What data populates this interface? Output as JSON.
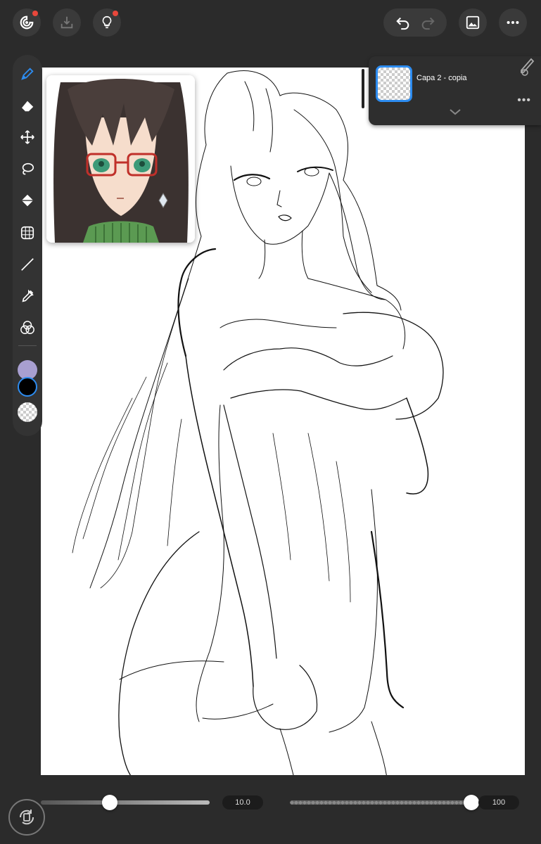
{
  "top_bar": {
    "icons": [
      "logo-icon",
      "import-icon",
      "lightbulb-icon",
      "undo-icon",
      "redo-icon",
      "gallery-icon",
      "more-icon"
    ],
    "notification_color": "#e8473b"
  },
  "tools": [
    "pen-icon",
    "eraser-icon",
    "move-icon",
    "lasso-icon",
    "fill-icon",
    "perspective-grid-icon",
    "line-icon",
    "eyedropper-icon",
    "blend-icon"
  ],
  "colors": {
    "primary": "#a89fd0",
    "secondary": "#000000",
    "accent": "#2d8cf0"
  },
  "layers_panel": {
    "layer_name": "Capa 2 - copia",
    "more_label": "•••"
  },
  "brush": {
    "size_value": "10.0",
    "size_level": 0.41,
    "opacity_value": "100",
    "opacity_level": 1.0
  }
}
